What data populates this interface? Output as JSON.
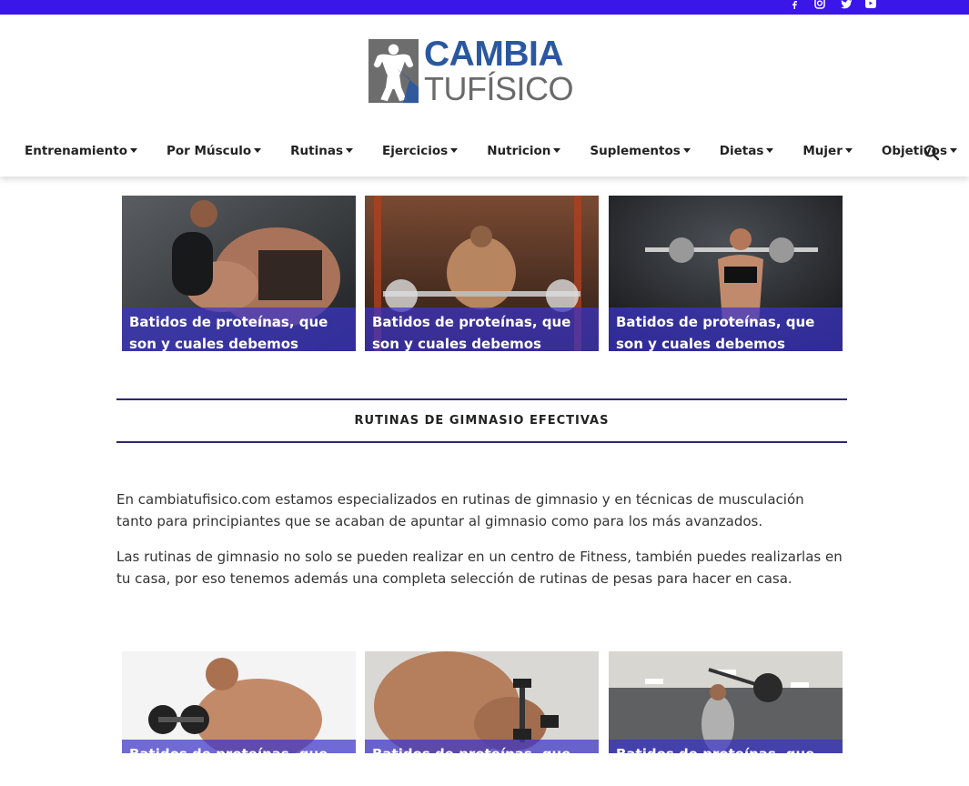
{
  "social": {
    "icons": [
      "facebook-icon",
      "instagram-icon",
      "twitter-icon",
      "youtube-icon"
    ],
    "color": "#ffffff",
    "bar_color": "#3a17e8"
  },
  "logo": {
    "line1": "CAMBIA",
    "line2": "TUFÍSICO"
  },
  "nav": {
    "items": [
      {
        "label": "Entrenamiento"
      },
      {
        "label": "Por Músculo"
      },
      {
        "label": "Rutinas"
      },
      {
        "label": "Ejercicios"
      },
      {
        "label": "Nutricion"
      },
      {
        "label": "Suplementos"
      },
      {
        "label": "Dietas"
      },
      {
        "label": "Mujer"
      },
      {
        "label": "Objetivos"
      }
    ],
    "search_icon": "search-icon"
  },
  "top_cards": [
    {
      "title": "Batidos de proteínas, que son y cuales debemos comprar"
    },
    {
      "title": "Batidos de proteínas, que son y cuales debemos comprar"
    },
    {
      "title": "Batidos de proteínas, que son y cuales debemos comprar"
    }
  ],
  "section": {
    "title": "RUTINAS DE GIMNASIO EFECTIVAS",
    "line_color": "#2c2870"
  },
  "content": {
    "paragraph1": "En cambiatufisico.com estamos especializados en rutinas de gimnasio y en técnicas de musculación tanto para principiantes que se acaban de apuntar al gimnasio como para los más avanzados.",
    "paragraph2": "Las rutinas de gimnasio no solo se pueden realizar en un centro de Fitness, también puedes realizarlas en tu casa, por eso tenemos además una completa selección de rutinas de pesas para hacer en casa."
  },
  "bottom_cards": [
    {
      "title": "Batidos de proteínas, que son y"
    },
    {
      "title": "Batidos de proteínas, que son y"
    },
    {
      "title": "Batidos de proteínas, que son y"
    }
  ],
  "colors": {
    "accent": "#3a17e8",
    "caption_overlay": "#3c34c8",
    "logo_blue": "#2a58a0",
    "logo_gray": "#6a6a6a"
  }
}
